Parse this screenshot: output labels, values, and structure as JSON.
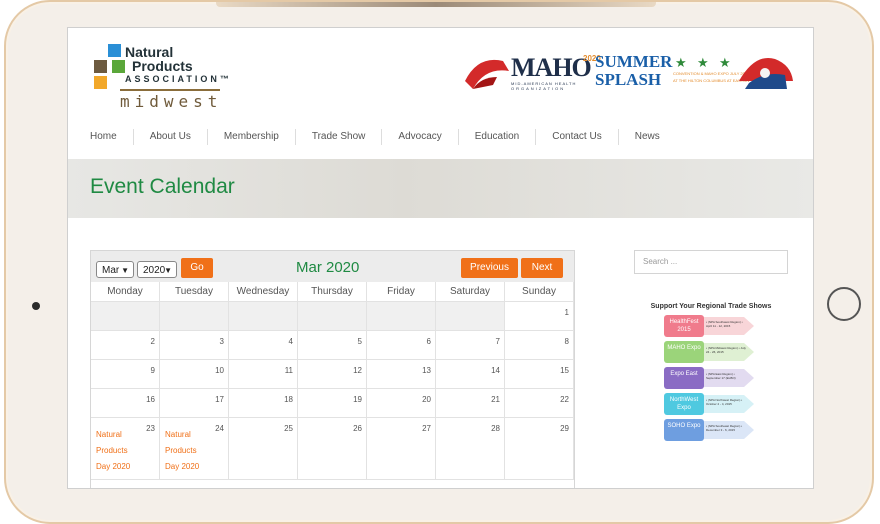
{
  "logo": {
    "line1": "Natural",
    "line2": "Products",
    "line3": "ASSOCIATION™",
    "line4": "midwest",
    "colors": {
      "blue": "#2a8fd6",
      "brown": "#6d5a3f",
      "green": "#5aa73a",
      "tan": "#e2b34b",
      "gold": "#f2a82a"
    }
  },
  "banner": {
    "maho": "MAHO",
    "sub1": "MID-AMERICAN HEALTH",
    "sub2": "ORGANIZATION",
    "year": "2020",
    "summer": "SUMMER",
    "splash": "SPLASH",
    "info1": "CONVENTION & MAHO EXPO JULY 20-22",
    "info2": "AT THE HILTON COLUMBUS AT EASTON"
  },
  "nav": {
    "items": [
      "Home",
      "About Us",
      "Membership",
      "Trade Show",
      "Advocacy",
      "Education",
      "Contact Us",
      "News"
    ]
  },
  "hero": {
    "title": "Event Calendar"
  },
  "calendar": {
    "month_select": "Mar",
    "year_select": "2020",
    "go_label": "Go",
    "title": "Mar 2020",
    "previous_label": "Previous",
    "next_label": "Next",
    "weekdays": [
      "Monday",
      "Tuesday",
      "Wednesday",
      "Thursday",
      "Friday",
      "Saturday",
      "Sunday"
    ],
    "weeks": [
      [
        "",
        "",
        "",
        "",
        "",
        "",
        "1"
      ],
      [
        "2",
        "3",
        "4",
        "5",
        "6",
        "7",
        "8"
      ],
      [
        "9",
        "10",
        "11",
        "12",
        "13",
        "14",
        "15"
      ],
      [
        "16",
        "17",
        "18",
        "19",
        "20",
        "21",
        "22"
      ],
      [
        "23",
        "24",
        "25",
        "26",
        "27",
        "28",
        "29"
      ]
    ],
    "event_text": "Natural Products Day 2020",
    "accent_color": "#f07018",
    "title_color": "#1f8a43"
  },
  "sidebar": {
    "search_placeholder": "Search ...",
    "ad_title": "Support Your Regional Trade Shows",
    "shows": [
      {
        "name": "HealthFest 2015",
        "info": "• (NPA Southwest Region) • April 11 - 12, 2015",
        "color": "#f07b8c"
      },
      {
        "name": "MAHO Expo",
        "info": "• (NPA Midwest Region) • July 24 - 26, 2015",
        "color": "#9bd47a"
      },
      {
        "name": "Expo East",
        "info": "• (NPA East Region) • September 17 (ELBO)",
        "color": "#8a6cc4"
      },
      {
        "name": "NorthWest Expo",
        "info": "• (NPA Northwest Region) • October 2 - 4, 2015",
        "color": "#4fc9e0"
      },
      {
        "name": "SOHO Expo",
        "info": "• (NPA Southeast Region) • December 3 - 6, 2015",
        "color": "#6e9ee0"
      }
    ]
  }
}
